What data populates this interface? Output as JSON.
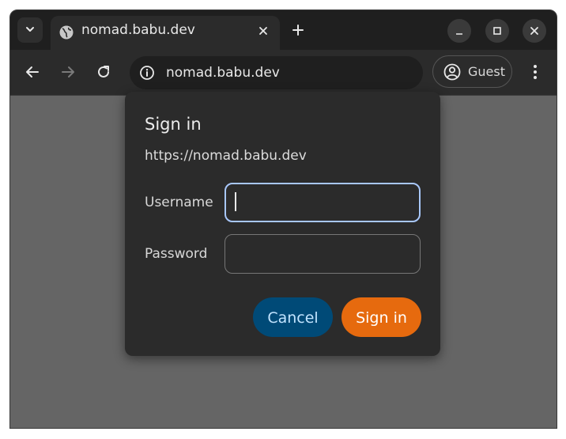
{
  "browser": {
    "tab": {
      "title": "nomad.babu.dev",
      "favicon": "globe-icon"
    },
    "address_bar": {
      "url": "nomad.babu.dev",
      "icon": "info-icon"
    },
    "profile": {
      "label": "Guest",
      "icon": "account-circle-icon"
    },
    "icons": {
      "tab_search": "chevron-down-icon",
      "tab_close": "close-icon",
      "new_tab": "plus-icon",
      "back": "arrow-left-icon",
      "forward": "arrow-right-icon",
      "reload": "reload-icon",
      "menu": "more-vert-icon",
      "minimize": "minimize-icon",
      "maximize": "maximize-icon",
      "close_window": "close-icon"
    }
  },
  "dialog": {
    "title": "Sign in",
    "origin": "https://nomad.babu.dev",
    "username": {
      "label": "Username",
      "value": "",
      "placeholder": ""
    },
    "password": {
      "label": "Password",
      "value": "",
      "placeholder": ""
    },
    "cancel_label": "Cancel",
    "signin_label": "Sign in"
  },
  "colors": {
    "accent_focus": "#a8c7fa",
    "cancel_bg": "#004a77",
    "signin_bg": "#e66a0e",
    "page_bg": "#656565"
  }
}
